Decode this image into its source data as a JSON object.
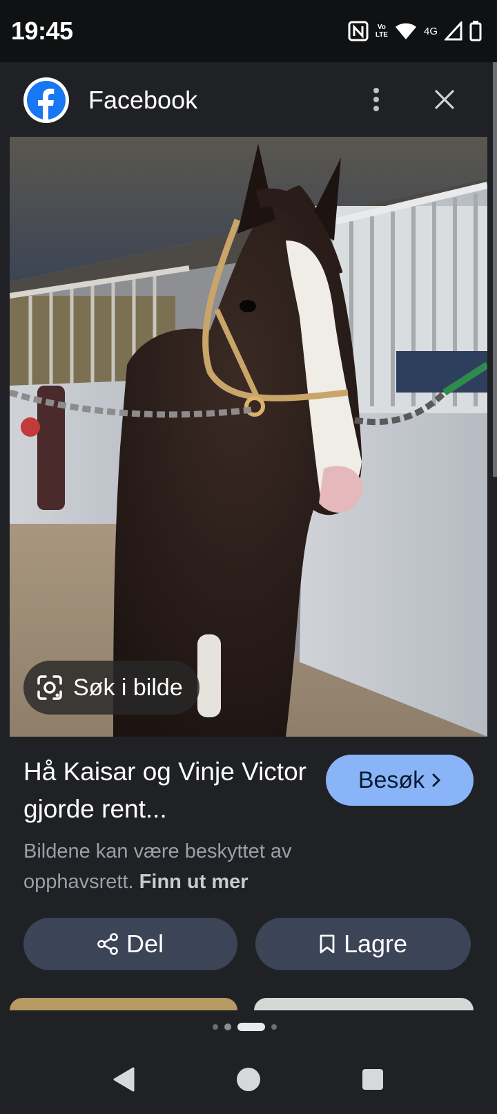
{
  "status_bar": {
    "time": "19:45",
    "network": "4G",
    "icons": [
      "nfc-icon",
      "volte-icon",
      "wifi-icon",
      "signal-icon",
      "battery-icon"
    ]
  },
  "header": {
    "source_name": "Facebook",
    "logo_icon": "facebook-logo-icon",
    "menu_icon": "more-vertical-icon",
    "close_icon": "close-icon"
  },
  "image": {
    "lens_label": "Søk i bilde",
    "lens_icon": "google-lens-icon"
  },
  "result": {
    "title": "Hå Kaisar og Vinje Victor gjorde rent...",
    "visit_label": "Besøk",
    "copyright_text": "Bildene kan være beskyttet av opphavsrett.",
    "learn_more": "Finn ut mer"
  },
  "actions": {
    "share_label": "Del",
    "save_label": "Lagre"
  },
  "navigation": {
    "back_icon": "back-triangle-icon",
    "home_icon": "home-circle-icon",
    "recents_icon": "recents-square-icon"
  },
  "colors": {
    "accent": "#8ab4f8",
    "button_bg": "#3c4457",
    "background": "#1f2125",
    "facebook_blue": "#1877f2"
  }
}
